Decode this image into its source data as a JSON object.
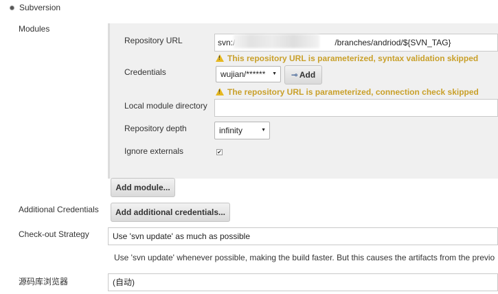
{
  "section": {
    "title": "Subversion"
  },
  "modules": {
    "label": "Modules",
    "repository_url": {
      "label": "Repository URL",
      "value_prefix": "svn:/",
      "value_suffix": "/branches/andriod/${SVN_TAG}",
      "warning": "This repository URL is parameterized, syntax validation skipped"
    },
    "credentials": {
      "label": "Credentials",
      "selected": "wujian/******",
      "add_button": "Add",
      "warning": "The repository URL is parameterized, connection check skipped"
    },
    "local_module_directory": {
      "label": "Local module directory",
      "value": ""
    },
    "repository_depth": {
      "label": "Repository depth",
      "selected": "infinity"
    },
    "ignore_externals": {
      "label": "Ignore externals",
      "checked": true,
      "mark": "✔"
    },
    "add_module_button": "Add module..."
  },
  "additional_credentials": {
    "label": "Additional Credentials",
    "button": "Add additional credentials..."
  },
  "checkout_strategy": {
    "label": "Check-out Strategy",
    "selected": "Use 'svn update' as much as possible",
    "description": "Use 'svn update' whenever possible, making the build faster. But this causes the artifacts from the previo"
  },
  "repo_browser": {
    "label": "源码库浏览器",
    "selected": "(自动)"
  },
  "colors": {
    "warning_text": "#c9a02a",
    "warning_icon": "#e6b820",
    "panel_background": "#f0f0f0"
  }
}
